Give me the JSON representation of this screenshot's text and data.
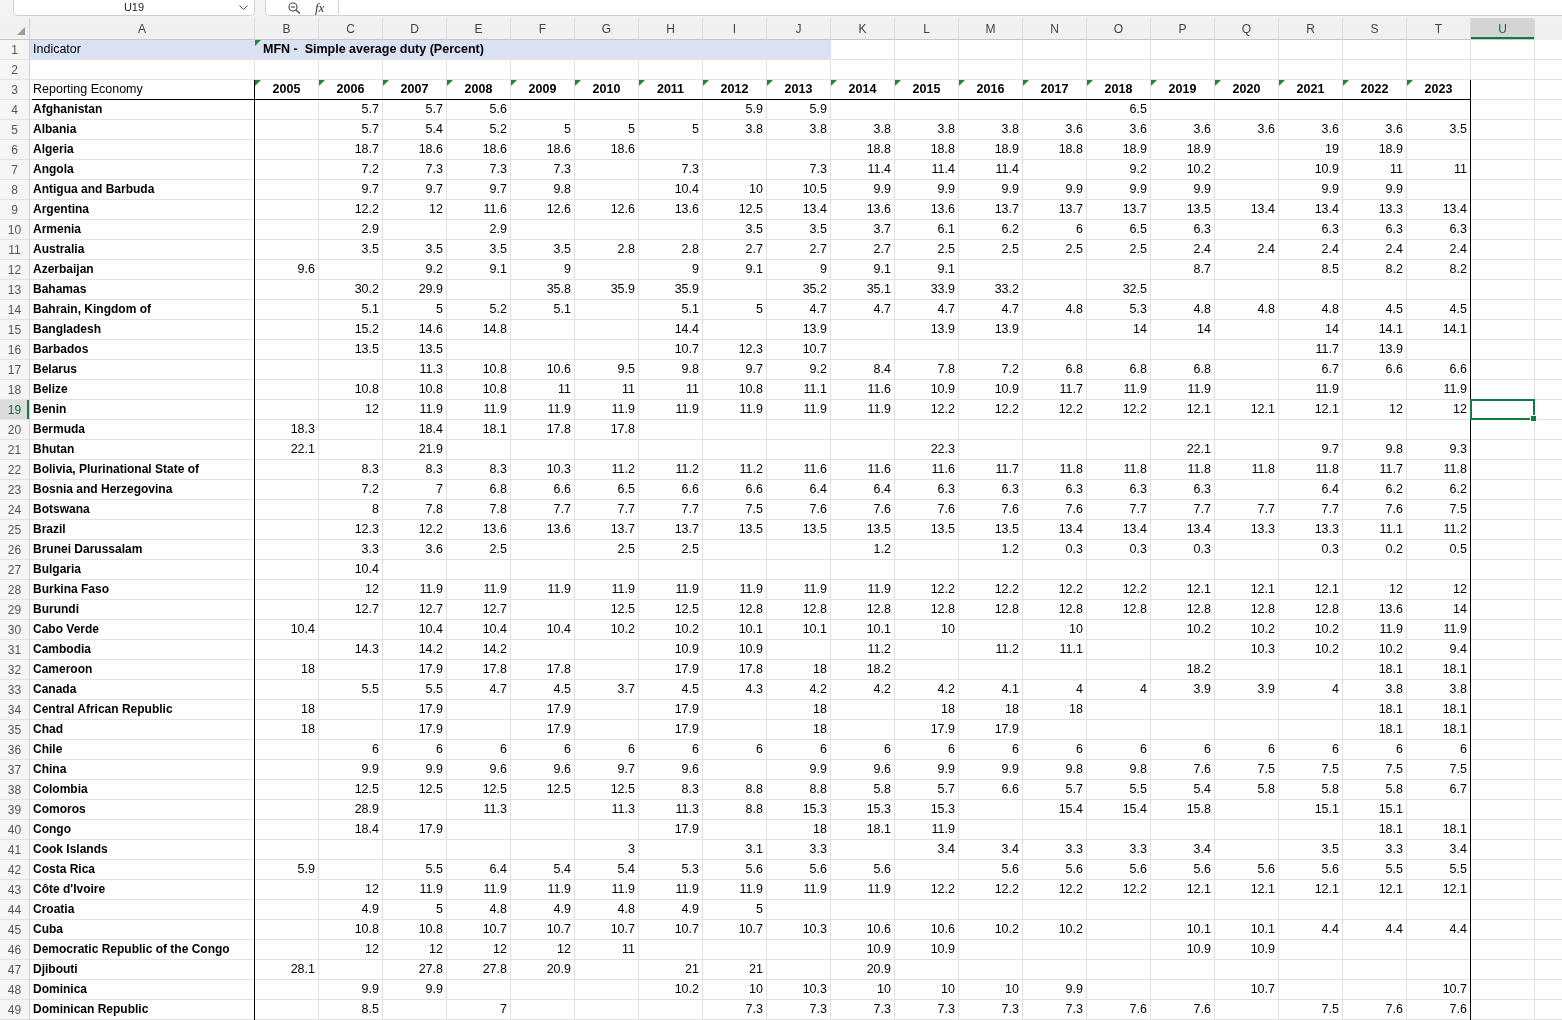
{
  "formula_bar": {
    "name_box": "U19",
    "function_label": "fx"
  },
  "column_headers": [
    {
      "label": "A",
      "selected": false
    },
    {
      "label": "B",
      "selected": false
    },
    {
      "label": "C",
      "selected": false
    },
    {
      "label": "D",
      "selected": false
    },
    {
      "label": "E",
      "selected": false
    },
    {
      "label": "F",
      "selected": false
    },
    {
      "label": "G",
      "selected": false
    },
    {
      "label": "H",
      "selected": false
    },
    {
      "label": "I",
      "selected": false
    },
    {
      "label": "J",
      "selected": false
    },
    {
      "label": "K",
      "selected": false
    },
    {
      "label": "L",
      "selected": false
    },
    {
      "label": "M",
      "selected": false
    },
    {
      "label": "N",
      "selected": false
    },
    {
      "label": "O",
      "selected": false
    },
    {
      "label": "P",
      "selected": false
    },
    {
      "label": "Q",
      "selected": false
    },
    {
      "label": "R",
      "selected": false
    },
    {
      "label": "S",
      "selected": false
    },
    {
      "label": "T",
      "selected": false
    },
    {
      "label": "U",
      "selected": true
    }
  ],
  "row_headers": [
    {
      "label": "1",
      "selected": false
    },
    {
      "label": "2",
      "selected": false
    },
    {
      "label": "3",
      "selected": false
    },
    {
      "label": "4",
      "selected": false
    },
    {
      "label": "5",
      "selected": false
    },
    {
      "label": "6",
      "selected": false
    },
    {
      "label": "7",
      "selected": false
    },
    {
      "label": "8",
      "selected": false
    },
    {
      "label": "9",
      "selected": false
    },
    {
      "label": "10",
      "selected": false
    },
    {
      "label": "11",
      "selected": false
    },
    {
      "label": "12",
      "selected": false
    },
    {
      "label": "13",
      "selected": false
    },
    {
      "label": "14",
      "selected": false
    },
    {
      "label": "15",
      "selected": false
    },
    {
      "label": "16",
      "selected": false
    },
    {
      "label": "17",
      "selected": false
    },
    {
      "label": "18",
      "selected": false
    },
    {
      "label": "19",
      "selected": true
    },
    {
      "label": "20",
      "selected": false
    },
    {
      "label": "21",
      "selected": false
    },
    {
      "label": "22",
      "selected": false
    },
    {
      "label": "23",
      "selected": false
    },
    {
      "label": "24",
      "selected": false
    },
    {
      "label": "25",
      "selected": false
    },
    {
      "label": "26",
      "selected": false
    },
    {
      "label": "27",
      "selected": false
    },
    {
      "label": "28",
      "selected": false
    },
    {
      "label": "29",
      "selected": false
    },
    {
      "label": "30",
      "selected": false
    },
    {
      "label": "31",
      "selected": false
    },
    {
      "label": "32",
      "selected": false
    },
    {
      "label": "33",
      "selected": false
    },
    {
      "label": "34",
      "selected": false
    },
    {
      "label": "35",
      "selected": false
    },
    {
      "label": "36",
      "selected": false
    },
    {
      "label": "37",
      "selected": false
    },
    {
      "label": "38",
      "selected": false
    },
    {
      "label": "39",
      "selected": false
    },
    {
      "label": "40",
      "selected": false
    },
    {
      "label": "41",
      "selected": false
    },
    {
      "label": "42",
      "selected": false
    },
    {
      "label": "43",
      "selected": false
    },
    {
      "label": "44",
      "selected": false
    },
    {
      "label": "45",
      "selected": false
    },
    {
      "label": "46",
      "selected": false
    },
    {
      "label": "47",
      "selected": false
    },
    {
      "label": "48",
      "selected": false
    },
    {
      "label": "49",
      "selected": false
    }
  ],
  "indicator": {
    "label": "Indicator",
    "value": "MFN -  Simple average duty (Percent)",
    "flagged": true
  },
  "table": {
    "row_label_heading": "Reporting Economy",
    "columns": [
      {
        "label": "2005",
        "flagged": true
      },
      {
        "label": "2006",
        "flagged": true
      },
      {
        "label": "2007",
        "flagged": true
      },
      {
        "label": "2008",
        "flagged": true
      },
      {
        "label": "2009",
        "flagged": true
      },
      {
        "label": "2010",
        "flagged": true
      },
      {
        "label": "2011",
        "flagged": true
      },
      {
        "label": "2012",
        "flagged": true
      },
      {
        "label": "2013",
        "flagged": true
      },
      {
        "label": "2014",
        "flagged": true
      },
      {
        "label": "2015",
        "flagged": true
      },
      {
        "label": "2016",
        "flagged": true
      },
      {
        "label": "2017",
        "flagged": true
      },
      {
        "label": "2018",
        "flagged": true
      },
      {
        "label": "2019",
        "flagged": true
      },
      {
        "label": "2020",
        "flagged": true
      },
      {
        "label": "2021",
        "flagged": true
      },
      {
        "label": "2022",
        "flagged": true
      },
      {
        "label": "2023",
        "flagged": true
      }
    ],
    "rows": [
      {
        "economy": "Afghanistan",
        "values": {
          "C": "5.7",
          "D": "5.7",
          "E": "5.6",
          "I": "5.9",
          "J": "5.9",
          "O": "6.5"
        }
      },
      {
        "economy": "Albania",
        "values": {
          "C": "5.7",
          "D": "5.4",
          "E": "5.2",
          "F": "5",
          "G": "5",
          "H": "5",
          "I": "3.8",
          "J": "3.8",
          "K": "3.8",
          "L": "3.8",
          "M": "3.8",
          "N": "3.6",
          "O": "3.6",
          "P": "3.6",
          "Q": "3.6",
          "R": "3.6",
          "S": "3.6",
          "T": "3.5"
        }
      },
      {
        "economy": "Algeria",
        "values": {
          "C": "18.7",
          "D": "18.6",
          "E": "18.6",
          "F": "18.6",
          "G": "18.6",
          "K": "18.8",
          "L": "18.8",
          "M": "18.9",
          "N": "18.8",
          "O": "18.9",
          "P": "18.9",
          "R": "19",
          "S": "18.9"
        }
      },
      {
        "economy": "Angola",
        "values": {
          "C": "7.2",
          "D": "7.3",
          "E": "7.3",
          "F": "7.3",
          "H": "7.3",
          "J": "7.3",
          "K": "11.4",
          "L": "11.4",
          "M": "11.4",
          "O": "9.2",
          "P": "10.2",
          "R": "10.9",
          "S": "11",
          "T": "11"
        }
      },
      {
        "economy": "Antigua and Barbuda",
        "values": {
          "C": "9.7",
          "D": "9.7",
          "E": "9.7",
          "F": "9.8",
          "H": "10.4",
          "I": "10",
          "J": "10.5",
          "K": "9.9",
          "L": "9.9",
          "M": "9.9",
          "N": "9.9",
          "O": "9.9",
          "P": "9.9",
          "R": "9.9",
          "S": "9.9"
        }
      },
      {
        "economy": "Argentina",
        "values": {
          "C": "12.2",
          "D": "12",
          "E": "11.6",
          "F": "12.6",
          "G": "12.6",
          "H": "13.6",
          "I": "12.5",
          "J": "13.4",
          "K": "13.6",
          "L": "13.6",
          "M": "13.7",
          "N": "13.7",
          "O": "13.7",
          "P": "13.5",
          "Q": "13.4",
          "R": "13.4",
          "S": "13.3",
          "T": "13.4"
        }
      },
      {
        "economy": "Armenia",
        "values": {
          "C": "2.9",
          "E": "2.9",
          "I": "3.5",
          "J": "3.5",
          "K": "3.7",
          "L": "6.1",
          "M": "6.2",
          "N": "6",
          "O": "6.5",
          "P": "6.3",
          "R": "6.3",
          "S": "6.3",
          "T": "6.3"
        }
      },
      {
        "economy": "Australia",
        "values": {
          "C": "3.5",
          "D": "3.5",
          "E": "3.5",
          "F": "3.5",
          "G": "2.8",
          "H": "2.8",
          "I": "2.7",
          "J": "2.7",
          "K": "2.7",
          "L": "2.5",
          "M": "2.5",
          "N": "2.5",
          "O": "2.5",
          "P": "2.4",
          "Q": "2.4",
          "R": "2.4",
          "S": "2.4",
          "T": "2.4"
        }
      },
      {
        "economy": "Azerbaijan",
        "values": {
          "B": "9.6",
          "D": "9.2",
          "E": "9.1",
          "F": "9",
          "H": "9",
          "I": "9.1",
          "J": "9",
          "K": "9.1",
          "L": "9.1",
          "P": "8.7",
          "R": "8.5",
          "S": "8.2",
          "T": "8.2"
        }
      },
      {
        "economy": "Bahamas",
        "values": {
          "C": "30.2",
          "D": "29.9",
          "F": "35.8",
          "G": "35.9",
          "H": "35.9",
          "J": "35.2",
          "K": "35.1",
          "L": "33.9",
          "M": "33.2",
          "O": "32.5"
        }
      },
      {
        "economy": "Bahrain, Kingdom of",
        "values": {
          "C": "5.1",
          "D": "5",
          "E": "5.2",
          "F": "5.1",
          "H": "5.1",
          "I": "5",
          "J": "4.7",
          "K": "4.7",
          "L": "4.7",
          "M": "4.7",
          "N": "4.8",
          "O": "5.3",
          "P": "4.8",
          "Q": "4.8",
          "R": "4.8",
          "S": "4.5",
          "T": "4.5"
        }
      },
      {
        "economy": "Bangladesh",
        "values": {
          "C": "15.2",
          "D": "14.6",
          "E": "14.8",
          "H": "14.4",
          "J": "13.9",
          "L": "13.9",
          "M": "13.9",
          "O": "14",
          "P": "14",
          "R": "14",
          "S": "14.1",
          "T": "14.1"
        }
      },
      {
        "economy": "Barbados",
        "values": {
          "C": "13.5",
          "D": "13.5",
          "H": "10.7",
          "I": "12.3",
          "J": "10.7",
          "R": "11.7",
          "S": "13.9"
        }
      },
      {
        "economy": "Belarus",
        "values": {
          "D": "11.3",
          "E": "10.8",
          "F": "10.6",
          "G": "9.5",
          "H": "9.8",
          "I": "9.7",
          "J": "9.2",
          "K": "8.4",
          "L": "7.8",
          "M": "7.2",
          "N": "6.8",
          "O": "6.8",
          "P": "6.8",
          "R": "6.7",
          "S": "6.6",
          "T": "6.6"
        }
      },
      {
        "economy": "Belize",
        "values": {
          "C": "10.8",
          "D": "10.8",
          "E": "10.8",
          "F": "11",
          "G": "11",
          "H": "11",
          "I": "10.8",
          "J": "11.1",
          "K": "11.6",
          "L": "10.9",
          "M": "10.9",
          "N": "11.7",
          "O": "11.9",
          "P": "11.9",
          "R": "11.9",
          "T": "11.9"
        }
      },
      {
        "economy": "Benin",
        "values": {
          "C": "12",
          "D": "11.9",
          "E": "11.9",
          "F": "11.9",
          "G": "11.9",
          "H": "11.9",
          "I": "11.9",
          "J": "11.9",
          "K": "11.9",
          "L": "12.2",
          "M": "12.2",
          "N": "12.2",
          "O": "12.2",
          "P": "12.1",
          "Q": "12.1",
          "R": "12.1",
          "S": "12",
          "T": "12"
        }
      },
      {
        "economy": "Bermuda",
        "values": {
          "B": "18.3",
          "D": "18.4",
          "E": "18.1",
          "F": "17.8",
          "G": "17.8"
        }
      },
      {
        "economy": "Bhutan",
        "values": {
          "B": "22.1",
          "D": "21.9",
          "L": "22.3",
          "P": "22.1",
          "R": "9.7",
          "S": "9.8",
          "T": "9.3"
        }
      },
      {
        "economy": "Bolivia, Plurinational State of",
        "values": {
          "C": "8.3",
          "D": "8.3",
          "E": "8.3",
          "F": "10.3",
          "G": "11.2",
          "H": "11.2",
          "I": "11.2",
          "J": "11.6",
          "K": "11.6",
          "L": "11.6",
          "M": "11.7",
          "N": "11.8",
          "O": "11.8",
          "P": "11.8",
          "Q": "11.8",
          "R": "11.8",
          "S": "11.7",
          "T": "11.8"
        }
      },
      {
        "economy": "Bosnia and Herzegovina",
        "values": {
          "C": "7.2",
          "D": "7",
          "E": "6.8",
          "F": "6.6",
          "G": "6.5",
          "H": "6.6",
          "I": "6.6",
          "J": "6.4",
          "K": "6.4",
          "L": "6.3",
          "M": "6.3",
          "N": "6.3",
          "O": "6.3",
          "P": "6.3",
          "R": "6.4",
          "S": "6.2",
          "T": "6.2"
        }
      },
      {
        "economy": "Botswana",
        "values": {
          "C": "8",
          "D": "7.8",
          "E": "7.8",
          "F": "7.7",
          "G": "7.7",
          "H": "7.7",
          "I": "7.5",
          "J": "7.6",
          "K": "7.6",
          "L": "7.6",
          "M": "7.6",
          "N": "7.6",
          "O": "7.7",
          "P": "7.7",
          "Q": "7.7",
          "R": "7.7",
          "S": "7.6",
          "T": "7.5"
        }
      },
      {
        "economy": "Brazil",
        "values": {
          "C": "12.3",
          "D": "12.2",
          "E": "13.6",
          "F": "13.6",
          "G": "13.7",
          "H": "13.7",
          "I": "13.5",
          "J": "13.5",
          "K": "13.5",
          "L": "13.5",
          "M": "13.5",
          "N": "13.4",
          "O": "13.4",
          "P": "13.4",
          "Q": "13.3",
          "R": "13.3",
          "S": "11.1",
          "T": "11.2"
        }
      },
      {
        "economy": "Brunei Darussalam",
        "values": {
          "C": "3.3",
          "D": "3.6",
          "E": "2.5",
          "G": "2.5",
          "H": "2.5",
          "K": "1.2",
          "M": "1.2",
          "N": "0.3",
          "O": "0.3",
          "P": "0.3",
          "R": "0.3",
          "S": "0.2",
          "T": "0.5"
        }
      },
      {
        "economy": "Bulgaria",
        "values": {
          "C": "10.4"
        }
      },
      {
        "economy": "Burkina Faso",
        "values": {
          "C": "12",
          "D": "11.9",
          "E": "11.9",
          "F": "11.9",
          "G": "11.9",
          "H": "11.9",
          "I": "11.9",
          "J": "11.9",
          "K": "11.9",
          "L": "12.2",
          "M": "12.2",
          "N": "12.2",
          "O": "12.2",
          "P": "12.1",
          "Q": "12.1",
          "R": "12.1",
          "S": "12",
          "T": "12"
        }
      },
      {
        "economy": "Burundi",
        "values": {
          "C": "12.7",
          "D": "12.7",
          "E": "12.7",
          "G": "12.5",
          "H": "12.5",
          "I": "12.8",
          "J": "12.8",
          "K": "12.8",
          "L": "12.8",
          "M": "12.8",
          "N": "12.8",
          "O": "12.8",
          "P": "12.8",
          "Q": "12.8",
          "R": "12.8",
          "S": "13.6",
          "T": "14"
        }
      },
      {
        "economy": "Cabo Verde",
        "values": {
          "B": "10.4",
          "D": "10.4",
          "E": "10.4",
          "F": "10.4",
          "G": "10.2",
          "H": "10.2",
          "I": "10.1",
          "J": "10.1",
          "K": "10.1",
          "L": "10",
          "N": "10",
          "P": "10.2",
          "Q": "10.2",
          "R": "10.2",
          "S": "11.9",
          "T": "11.9"
        }
      },
      {
        "economy": "Cambodia",
        "values": {
          "C": "14.3",
          "D": "14.2",
          "E": "14.2",
          "H": "10.9",
          "I": "10.9",
          "K": "11.2",
          "M": "11.2",
          "N": "11.1",
          "Q": "10.3",
          "R": "10.2",
          "S": "10.2",
          "T": "9.4"
        }
      },
      {
        "economy": "Cameroon",
        "values": {
          "B": "18",
          "D": "17.9",
          "E": "17.8",
          "F": "17.8",
          "H": "17.9",
          "I": "17.8",
          "J": "18",
          "K": "18.2",
          "P": "18.2",
          "S": "18.1",
          "T": "18.1"
        }
      },
      {
        "economy": "Canada",
        "values": {
          "C": "5.5",
          "D": "5.5",
          "E": "4.7",
          "F": "4.5",
          "G": "3.7",
          "H": "4.5",
          "I": "4.3",
          "J": "4.2",
          "K": "4.2",
          "L": "4.2",
          "M": "4.1",
          "N": "4",
          "O": "4",
          "P": "3.9",
          "Q": "3.9",
          "R": "4",
          "S": "3.8",
          "T": "3.8"
        }
      },
      {
        "economy": "Central African Republic",
        "values": {
          "B": "18",
          "D": "17.9",
          "F": "17.9",
          "H": "17.9",
          "J": "18",
          "L": "18",
          "M": "18",
          "N": "18",
          "S": "18.1",
          "T": "18.1"
        }
      },
      {
        "economy": "Chad",
        "values": {
          "B": "18",
          "D": "17.9",
          "F": "17.9",
          "H": "17.9",
          "J": "18",
          "L": "17.9",
          "M": "17.9",
          "S": "18.1",
          "T": "18.1"
        }
      },
      {
        "economy": "Chile",
        "values": {
          "C": "6",
          "D": "6",
          "E": "6",
          "F": "6",
          "G": "6",
          "H": "6",
          "I": "6",
          "J": "6",
          "K": "6",
          "L": "6",
          "M": "6",
          "N": "6",
          "O": "6",
          "P": "6",
          "Q": "6",
          "R": "6",
          "S": "6",
          "T": "6"
        }
      },
      {
        "economy": "China",
        "values": {
          "C": "9.9",
          "D": "9.9",
          "E": "9.6",
          "F": "9.6",
          "G": "9.7",
          "H": "9.6",
          "J": "9.9",
          "K": "9.6",
          "L": "9.9",
          "M": "9.9",
          "N": "9.8",
          "O": "9.8",
          "P": "7.6",
          "Q": "7.5",
          "R": "7.5",
          "S": "7.5",
          "T": "7.5"
        }
      },
      {
        "economy": "Colombia",
        "values": {
          "C": "12.5",
          "D": "12.5",
          "E": "12.5",
          "F": "12.5",
          "G": "12.5",
          "H": "8.3",
          "I": "8.8",
          "J": "8.8",
          "K": "5.8",
          "L": "5.7",
          "M": "6.6",
          "N": "5.7",
          "O": "5.5",
          "P": "5.4",
          "Q": "5.8",
          "R": "5.8",
          "S": "5.8",
          "T": "6.7"
        }
      },
      {
        "economy": "Comoros",
        "values": {
          "C": "28.9",
          "E": "11.3",
          "G": "11.3",
          "H": "11.3",
          "I": "8.8",
          "J": "15.3",
          "K": "15.3",
          "L": "15.3",
          "N": "15.4",
          "O": "15.4",
          "P": "15.8",
          "R": "15.1",
          "S": "15.1"
        }
      },
      {
        "economy": "Congo",
        "values": {
          "C": "18.4",
          "D": "17.9",
          "H": "17.9",
          "J": "18",
          "K": "18.1",
          "L": "11.9",
          "S": "18.1",
          "T": "18.1"
        }
      },
      {
        "economy": "Cook Islands",
        "values": {
          "G": "3",
          "I": "3.1",
          "J": "3.3",
          "L": "3.4",
          "M": "3.4",
          "N": "3.3",
          "O": "3.3",
          "P": "3.4",
          "R": "3.5",
          "S": "3.3",
          "T": "3.4"
        }
      },
      {
        "economy": "Costa Rica",
        "values": {
          "B": "5.9",
          "D": "5.5",
          "E": "6.4",
          "F": "5.4",
          "G": "5.4",
          "H": "5.3",
          "I": "5.6",
          "J": "5.6",
          "K": "5.6",
          "M": "5.6",
          "N": "5.6",
          "O": "5.6",
          "P": "5.6",
          "Q": "5.6",
          "R": "5.6",
          "S": "5.5",
          "T": "5.5"
        }
      },
      {
        "economy": "Côte d'Ivoire",
        "values": {
          "C": "12",
          "D": "11.9",
          "E": "11.9",
          "F": "11.9",
          "G": "11.9",
          "H": "11.9",
          "I": "11.9",
          "J": "11.9",
          "K": "11.9",
          "L": "12.2",
          "M": "12.2",
          "N": "12.2",
          "O": "12.2",
          "P": "12.1",
          "Q": "12.1",
          "R": "12.1",
          "S": "12.1",
          "T": "12.1"
        }
      },
      {
        "economy": "Croatia",
        "values": {
          "C": "4.9",
          "D": "5",
          "E": "4.8",
          "F": "4.9",
          "G": "4.8",
          "H": "4.9",
          "I": "5"
        }
      },
      {
        "economy": "Cuba",
        "values": {
          "C": "10.8",
          "D": "10.8",
          "E": "10.7",
          "F": "10.7",
          "G": "10.7",
          "H": "10.7",
          "I": "10.7",
          "J": "10.3",
          "K": "10.6",
          "L": "10.6",
          "M": "10.2",
          "N": "10.2",
          "P": "10.1",
          "Q": "10.1",
          "R": "4.4",
          "S": "4.4",
          "T": "4.4"
        }
      },
      {
        "economy": "Democratic Republic of the Congo",
        "values": {
          "C": "12",
          "D": "12",
          "E": "12",
          "F": "12",
          "G": "11",
          "K": "10.9",
          "L": "10.9",
          "P": "10.9",
          "Q": "10.9"
        }
      },
      {
        "economy": "Djibouti",
        "values": {
          "B": "28.1",
          "D": "27.8",
          "E": "27.8",
          "F": "20.9",
          "H": "21",
          "I": "21",
          "K": "20.9"
        }
      },
      {
        "economy": "Dominica",
        "values": {
          "C": "9.9",
          "D": "9.9",
          "H": "10.2",
          "I": "10",
          "J": "10.3",
          "K": "10",
          "L": "10",
          "M": "10",
          "N": "9.9",
          "Q": "10.7",
          "T": "10.7"
        }
      },
      {
        "economy": "Dominican Republic",
        "values": {
          "C": "8.5",
          "E": "7",
          "I": "7.3",
          "J": "7.3",
          "K": "7.3",
          "L": "7.3",
          "M": "7.3",
          "N": "7.3",
          "O": "7.6",
          "P": "7.6",
          "R": "7.5",
          "S": "7.6",
          "T": "7.6"
        }
      }
    ]
  }
}
